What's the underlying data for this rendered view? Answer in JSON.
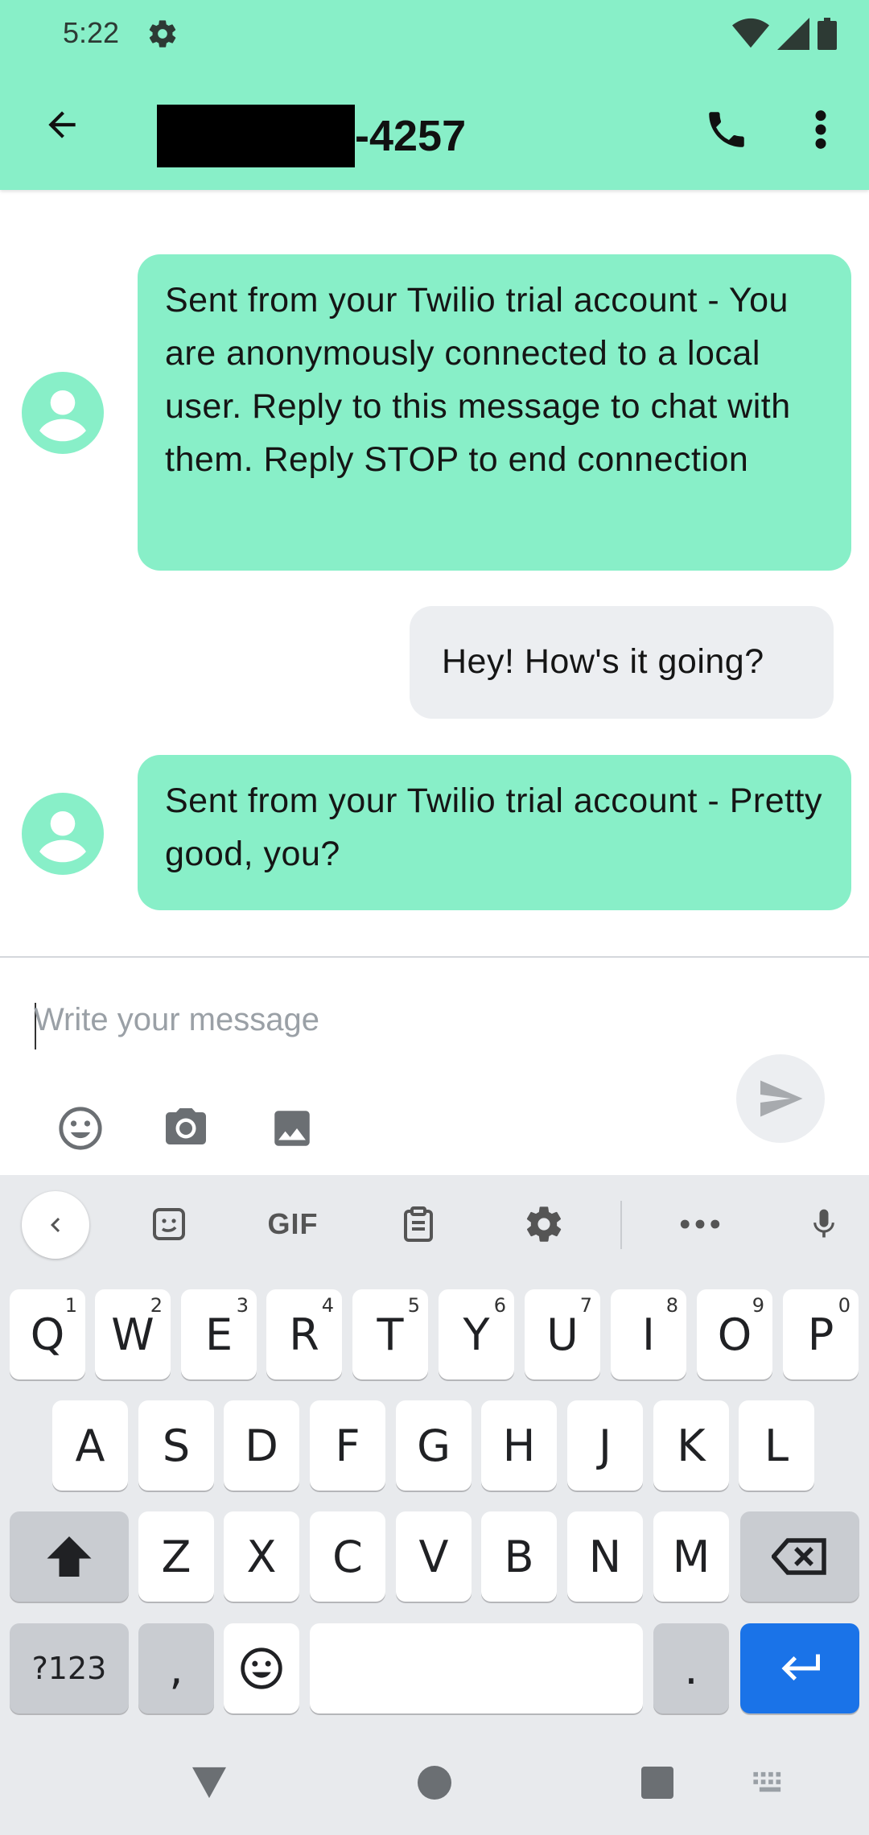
{
  "status_bar": {
    "time": "5:22"
  },
  "header": {
    "title_suffix": "-4257",
    "back_icon": "arrow-back-icon",
    "call_icon": "phone-icon",
    "more_icon": "more-vert-icon"
  },
  "messages": [
    {
      "direction": "incoming",
      "text": "Sent from your Twilio trial account - You are anonymously connected to a local user. Reply to this message to chat with them. Reply STOP to end connection"
    },
    {
      "direction": "outgoing",
      "text": "Hey! How's it going?"
    },
    {
      "direction": "incoming",
      "text": "Sent from your Twilio trial account - Pretty good, you?"
    }
  ],
  "composer": {
    "placeholder": "Write your message",
    "icons": [
      "emoji-icon",
      "camera-icon",
      "image-icon",
      "send-icon"
    ]
  },
  "keyboard": {
    "toolbar": {
      "gif_label": "GIF"
    },
    "row1": [
      {
        "k": "Q",
        "n": "1"
      },
      {
        "k": "W",
        "n": "2"
      },
      {
        "k": "E",
        "n": "3"
      },
      {
        "k": "R",
        "n": "4"
      },
      {
        "k": "T",
        "n": "5"
      },
      {
        "k": "Y",
        "n": "6"
      },
      {
        "k": "U",
        "n": "7"
      },
      {
        "k": "I",
        "n": "8"
      },
      {
        "k": "O",
        "n": "9"
      },
      {
        "k": "P",
        "n": "0"
      }
    ],
    "row2": [
      "A",
      "S",
      "D",
      "F",
      "G",
      "H",
      "J",
      "K",
      "L"
    ],
    "row3": [
      "Z",
      "X",
      "C",
      "V",
      "B",
      "N",
      "M"
    ],
    "row4": {
      "symbols": "?123",
      "comma": ",",
      "period": "."
    }
  },
  "colors": {
    "accent": "#88efc8",
    "outgoing_bubble": "#eceef1",
    "enter_key": "#1a73e8"
  }
}
